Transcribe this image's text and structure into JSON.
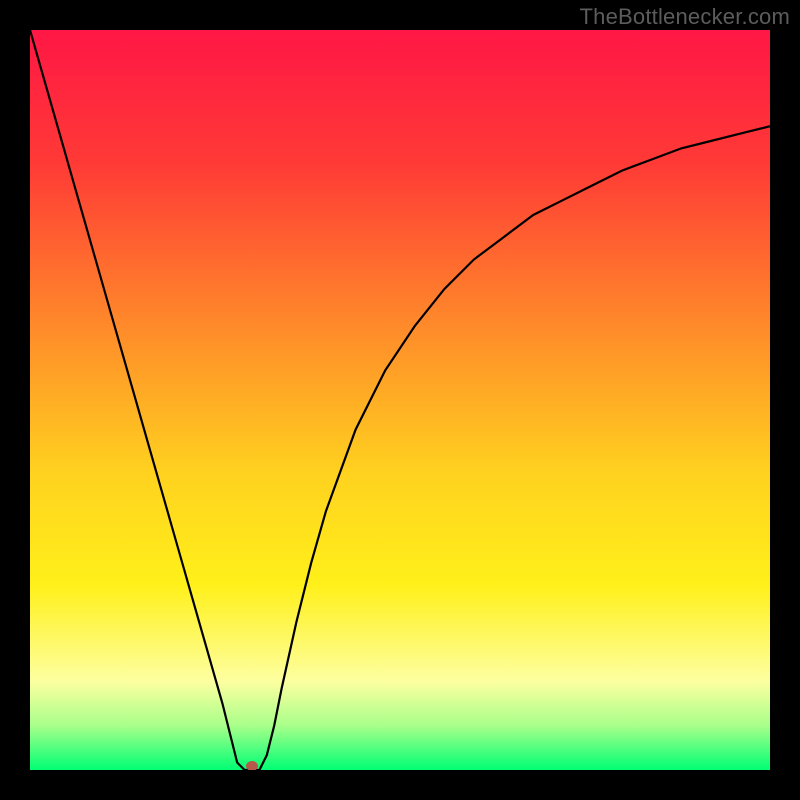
{
  "watermark": "TheBottlenecker.com",
  "chart_data": {
    "type": "line",
    "x": [
      0,
      2,
      4,
      6,
      8,
      10,
      12,
      14,
      16,
      18,
      20,
      22,
      24,
      26,
      27,
      28,
      29,
      30,
      31,
      32,
      33,
      34,
      36,
      38,
      40,
      44,
      48,
      52,
      56,
      60,
      64,
      68,
      72,
      76,
      80,
      84,
      88,
      92,
      96,
      100
    ],
    "values": [
      100,
      93,
      86,
      79,
      72,
      65,
      58,
      51,
      44,
      37,
      30,
      23,
      16,
      9,
      5,
      1,
      0,
      0,
      0,
      2,
      6,
      11,
      20,
      28,
      35,
      46,
      54,
      60,
      65,
      69,
      72,
      75,
      77,
      79,
      81,
      82.5,
      84,
      85,
      86,
      87
    ],
    "title": "",
    "xlabel": "",
    "ylabel": "",
    "xlim": [
      0,
      100
    ],
    "ylim": [
      0,
      100
    ],
    "gradient_stops": [
      {
        "offset": 0.0,
        "color": "#ff1745"
      },
      {
        "offset": 0.18,
        "color": "#ff3a36"
      },
      {
        "offset": 0.4,
        "color": "#ff8a2a"
      },
      {
        "offset": 0.6,
        "color": "#ffd21f"
      },
      {
        "offset": 0.75,
        "color": "#fff01a"
      },
      {
        "offset": 0.88,
        "color": "#fdffa0"
      },
      {
        "offset": 0.94,
        "color": "#a8ff8a"
      },
      {
        "offset": 1.0,
        "color": "#00ff74"
      }
    ],
    "marker": {
      "x": 30,
      "y": 0,
      "color": "#b55a4a"
    }
  }
}
